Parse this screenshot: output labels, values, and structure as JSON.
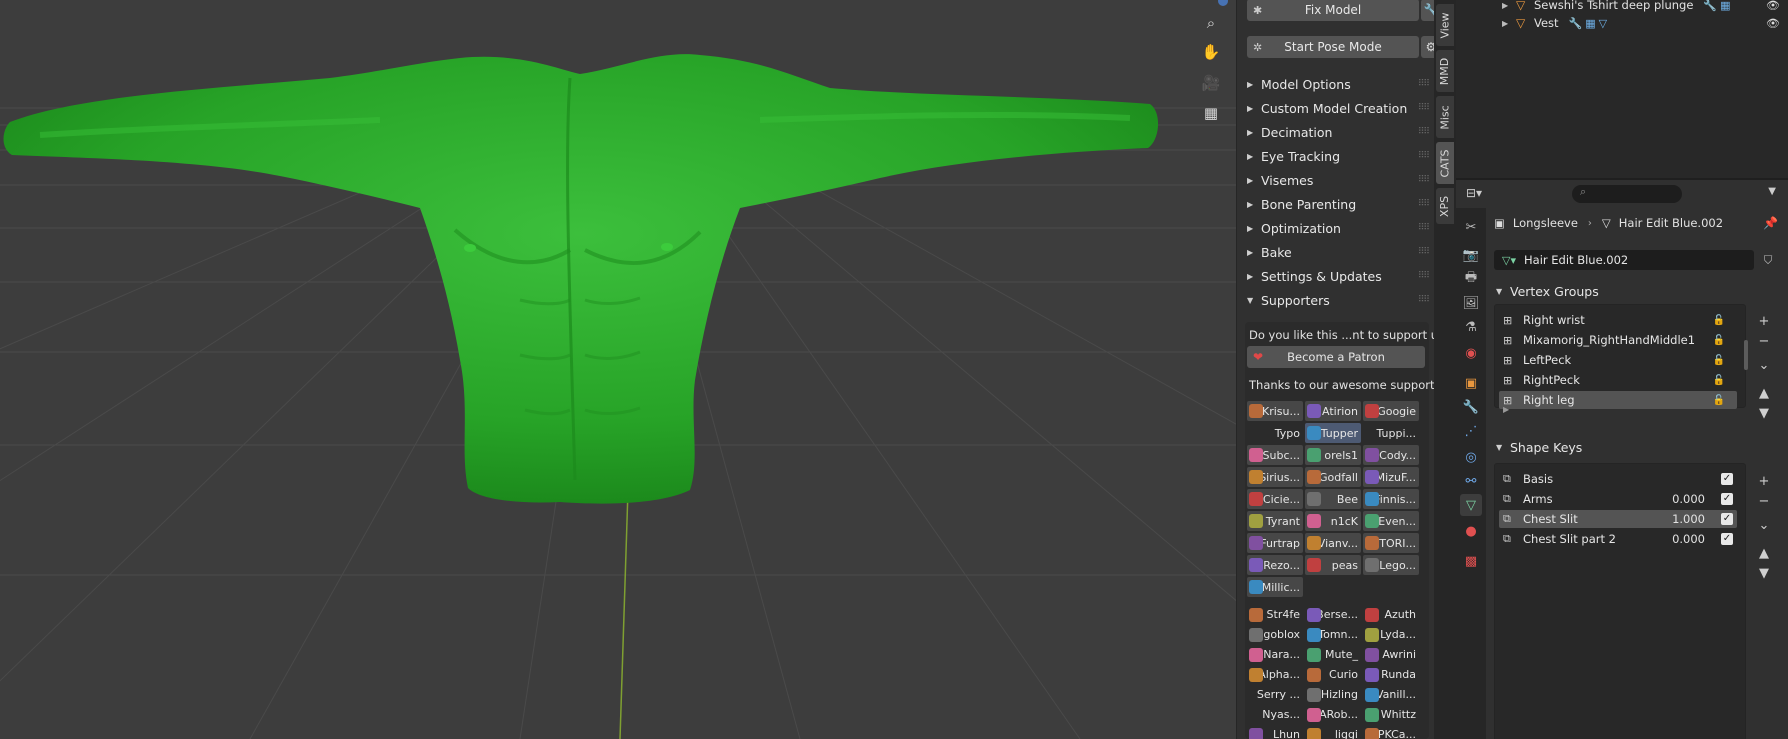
{
  "viewport": {
    "colors": {
      "background": "#3d3d3d",
      "grid": "#4a4a4a",
      "model": "#2ea82e",
      "axis": "#7fa031"
    },
    "gizmo_icons": [
      "zoom-icon",
      "hand-pan-icon",
      "camera-icon",
      "grid-icon"
    ]
  },
  "cats": {
    "fix_model": "Fix Model",
    "start_pose_mode": "Start Pose Mode",
    "panels": [
      "Model Options",
      "Custom Model Creation",
      "Decimation",
      "Eye Tracking",
      "Visemes",
      "Bone Parenting",
      "Optimization",
      "Bake",
      "Settings & Updates",
      "Supporters"
    ],
    "supporters": {
      "question": "Do you like this ...nt to support us?",
      "patron_button": "Become a Patron",
      "thanks": "Thanks to our awesome supporte...",
      "grid": [
        "Krisu...",
        "Atirion",
        "Googie",
        "Typo",
        "Tupper",
        "Tuppi...",
        "Subc...",
        "orels1",
        "Cody...",
        "Sirius...",
        "Godfall",
        "MizuF...",
        "Cicie...",
        "Bee",
        "Finnis...",
        "Tyrant",
        "n1cK",
        "Even...",
        "Furtrap",
        "Vianv...",
        "TORI...",
        "Rezo...",
        "peas",
        "Lego...",
        "Millic..."
      ],
      "grid2": [
        "Str4fe",
        "Berse...",
        "Azuth",
        "goblox",
        "Tomn...",
        "Lyda...",
        "Nara...",
        "Mute_",
        "Awrini",
        "Alpha...",
        "Curio",
        "Runda",
        "Serry ...",
        "Hizling",
        "Vanill...",
        "Nyas...",
        "ARob...",
        "Whittz",
        "Lhun",
        "liggi",
        "PKCa..."
      ]
    }
  },
  "tabs": [
    "View",
    "MMD",
    "Misc",
    "CATS",
    "XPS"
  ],
  "outliner": {
    "rows": [
      {
        "name": "Sewshi's Tshirt deep plunge"
      },
      {
        "name": "Vest"
      }
    ]
  },
  "properties": {
    "search_placeholder": "",
    "object_name": "Longsleeve",
    "mesh_name": "Hair Edit Blue.002",
    "mesh_field": "Hair Edit Blue.002",
    "vertex_groups_title": "Vertex Groups",
    "vertex_groups": [
      "Right wrist",
      "Mixamorig_RightHandMiddle1",
      "LeftPeck",
      "RightPeck",
      "Right leg"
    ],
    "shape_keys_title": "Shape Keys",
    "shape_keys": [
      {
        "name": "Basis",
        "value": ""
      },
      {
        "name": "Arms",
        "value": "0.000"
      },
      {
        "name": "Chest Slit",
        "value": "1.000"
      },
      {
        "name": "Chest Slit part 2",
        "value": "0.000"
      }
    ]
  }
}
